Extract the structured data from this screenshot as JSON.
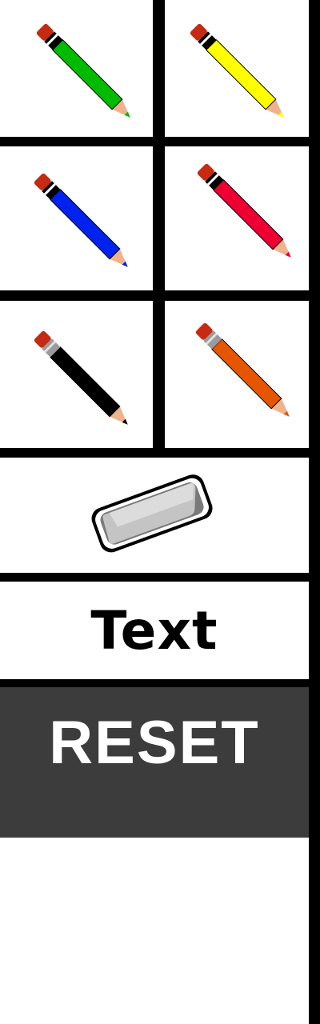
{
  "tools": {
    "pencils": [
      {
        "name": "green",
        "color": "#00bb00"
      },
      {
        "name": "yellow",
        "color": "#ffff00"
      },
      {
        "name": "blue",
        "color": "#0022ee"
      },
      {
        "name": "red",
        "color": "#ee0033"
      },
      {
        "name": "black",
        "color": "#000000"
      },
      {
        "name": "orange",
        "color": "#e65500"
      }
    ],
    "eraser_icon": "eraser-icon",
    "text_label": "Text",
    "reset_label": "RESET"
  },
  "colors": {
    "reset_background": "#3c3c3c",
    "separator": "#000000",
    "eraser_tip": "#c62a12",
    "pencil_wood": "#f0b28c"
  }
}
